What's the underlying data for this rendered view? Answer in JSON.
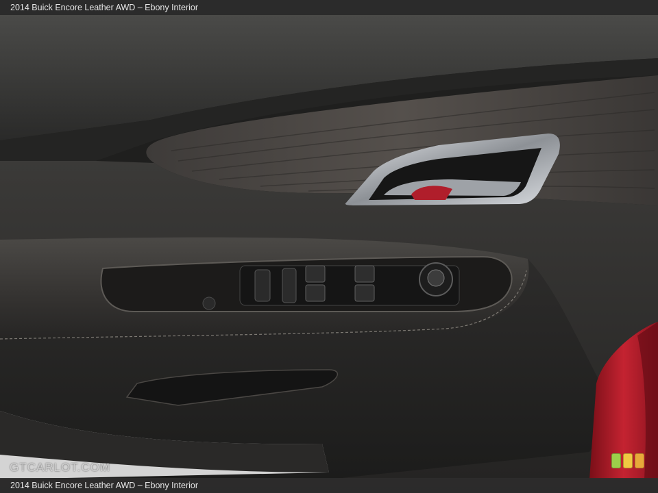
{
  "caption": {
    "top": "2014 Buick Encore Leather AWD – Ebony Interior",
    "bottom": "2014 Buick Encore Leather AWD – Ebony Interior"
  },
  "watermark": "GTCARLOT.COM",
  "colors": {
    "leather": "#2f2e2c",
    "wood_trim": "#4a4643",
    "chrome": "#c9ccd0",
    "body_paint": "#b3202c",
    "badge": [
      "#9ccf4a",
      "#f0c842",
      "#e8a83a"
    ]
  }
}
